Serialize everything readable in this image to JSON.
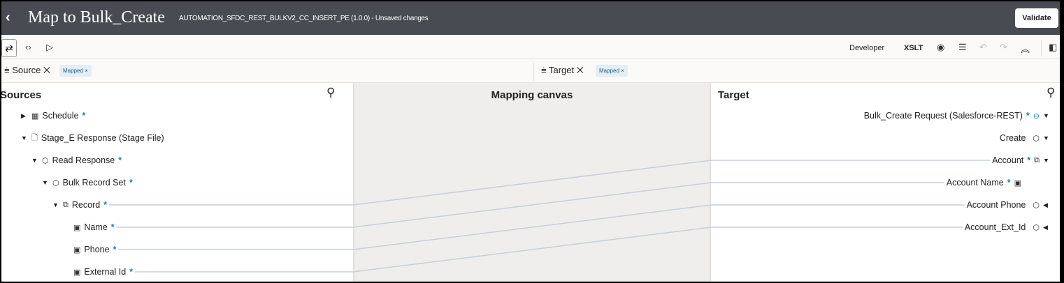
{
  "header": {
    "back": "‹",
    "title": "Map to Bulk_Create",
    "subtitle": "AUTOMATION_SFDC_REST_BULKV2_CC_INSERT_PE (1.0.0) - Unsaved changes",
    "validate": "Validate"
  },
  "toolbar": {
    "map_icon": "⇄",
    "code_icon": "‹›",
    "run_icon": "▷",
    "developer": "Developer",
    "xslt": "XSLT",
    "eye": "◉",
    "filter": "☰",
    "undo": "↶",
    "redo": "↷",
    "collapse": "︽",
    "panel": "◧"
  },
  "filters": {
    "source_label": "Source",
    "source_chip": "Mapped",
    "target_label": "Target",
    "target_chip": "Mapped",
    "close": "✕",
    "chip_close": "×",
    "filter_icon": "⩧"
  },
  "sources": {
    "title": "Sources",
    "rows": [
      {
        "label": "Schedule",
        "star": "*",
        "tri": "▶",
        "icon": "▦",
        "level": 0
      },
      {
        "label": "Stage_E Response (Stage File)",
        "star": "",
        "tri": "▼",
        "icon": "🗋",
        "level": 0
      },
      {
        "label": "Read Response",
        "star": "*",
        "tri": "▼",
        "icon": "⬡",
        "level": 1
      },
      {
        "label": "Bulk Record Set",
        "star": "*",
        "tri": "▼",
        "icon": "⬡",
        "level": 2
      },
      {
        "label": "Record",
        "star": "*",
        "tri": "▼",
        "icon": "⧉",
        "level": 3
      },
      {
        "label": "Name",
        "star": "*",
        "tri": "",
        "icon": "▣",
        "level": 4
      },
      {
        "label": "Phone",
        "star": "*",
        "tri": "",
        "icon": "▣",
        "level": 4
      },
      {
        "label": "External Id",
        "star": "*",
        "tri": "",
        "icon": "▣",
        "level": 4
      }
    ]
  },
  "canvas": {
    "title": "Mapping canvas"
  },
  "target": {
    "title": "Target",
    "rows": [
      {
        "label": "Bulk_Create Request (Salesforce-REST)",
        "star": "*",
        "icon": "⊖",
        "tri": "▼"
      },
      {
        "label": "Create",
        "star": "",
        "icon": "⬡",
        "tri": "▼"
      },
      {
        "label": "Account",
        "star": "*",
        "icon": "⧉",
        "tri": "▼"
      },
      {
        "label": "Account Name",
        "star": "*",
        "icon": "▣",
        "tri": ""
      },
      {
        "label": "Account Phone",
        "star": "",
        "icon": "⬡",
        "tri": "◀"
      },
      {
        "label": "Account_Ext_Id",
        "star": "",
        "icon": "⬡",
        "tri": "◀"
      }
    ]
  },
  "mappings": [
    {
      "source": 4,
      "target": 2
    },
    {
      "source": 5,
      "target": 3
    },
    {
      "source": 6,
      "target": 4
    },
    {
      "source": 7,
      "target": 5
    }
  ],
  "colors": {
    "header": "#484b52",
    "line": "#c5cfdd",
    "star": "#1d7fb4"
  }
}
